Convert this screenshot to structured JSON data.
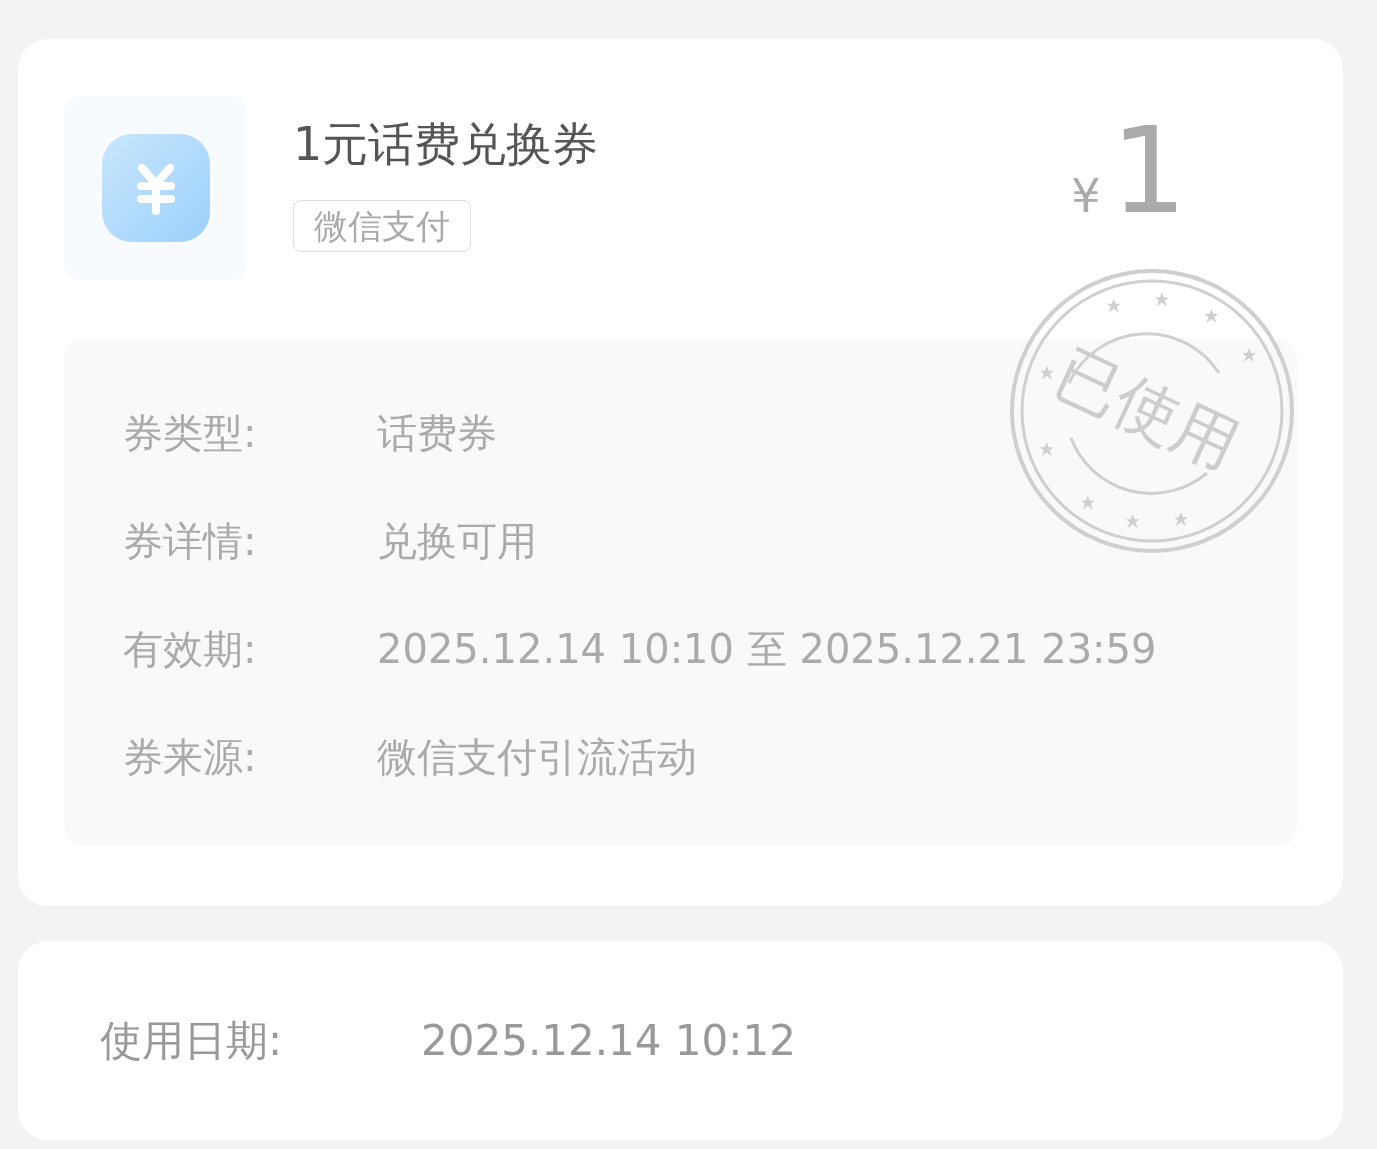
{
  "coupon": {
    "title": "1元话费兑换券",
    "tag": "微信支付",
    "currency": "¥",
    "amount": "1",
    "stamp": {
      "text": "已使用"
    },
    "details": [
      {
        "label": "券类型:",
        "value": "话费券"
      },
      {
        "label": "券详情:",
        "value": "兑换可用"
      },
      {
        "label": "有效期:",
        "value": "2025.12.14 10:10 至 2025.12.21 23:59"
      },
      {
        "label": "券来源:",
        "value": "微信支付引流活动"
      }
    ]
  },
  "usage": {
    "label": "使用日期:",
    "value": "2025.12.14 10:12"
  }
}
